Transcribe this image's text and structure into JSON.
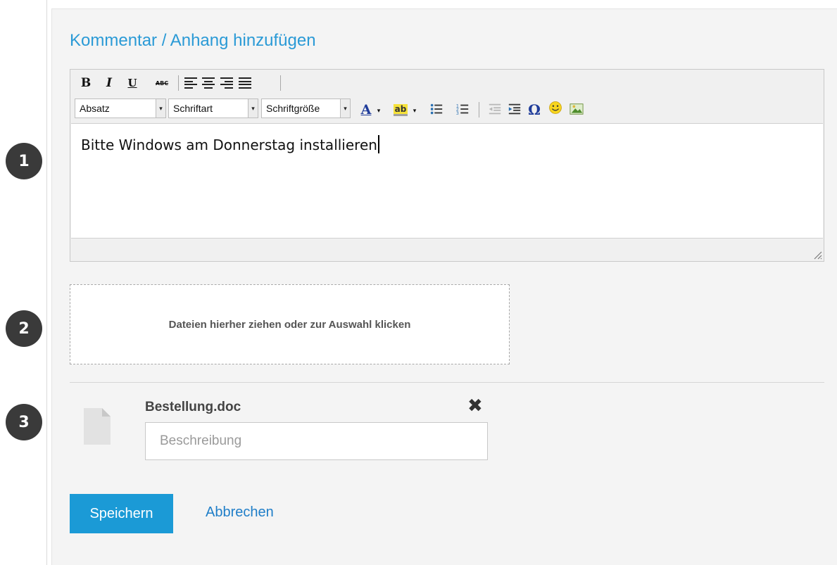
{
  "markers": [
    "1",
    "2",
    "3"
  ],
  "form": {
    "title": "Kommentar / Anhang hinzufügen"
  },
  "editor": {
    "toolbar": {
      "bold": "B",
      "italic": "I",
      "underline": "U",
      "strikethrough": "ABC",
      "format_select": "Absatz",
      "font_select": "Schriftart",
      "size_select": "Schriftgröße",
      "font_color": "A",
      "highlight": "ab"
    },
    "content": "Bitte Windows am Donnerstag installieren"
  },
  "dropzone": {
    "text": "Dateien hierher ziehen oder zur Auswahl klicken"
  },
  "attachment": {
    "filename": "Bestellung.doc",
    "description_placeholder": "Beschreibung"
  },
  "actions": {
    "save_label": "Speichern",
    "cancel_label": "Abbrechen"
  },
  "colors": {
    "accent": "#1b9ad6",
    "title": "#2a9ad6",
    "link": "#1f7ec8",
    "marker": "#3a3a3a"
  }
}
